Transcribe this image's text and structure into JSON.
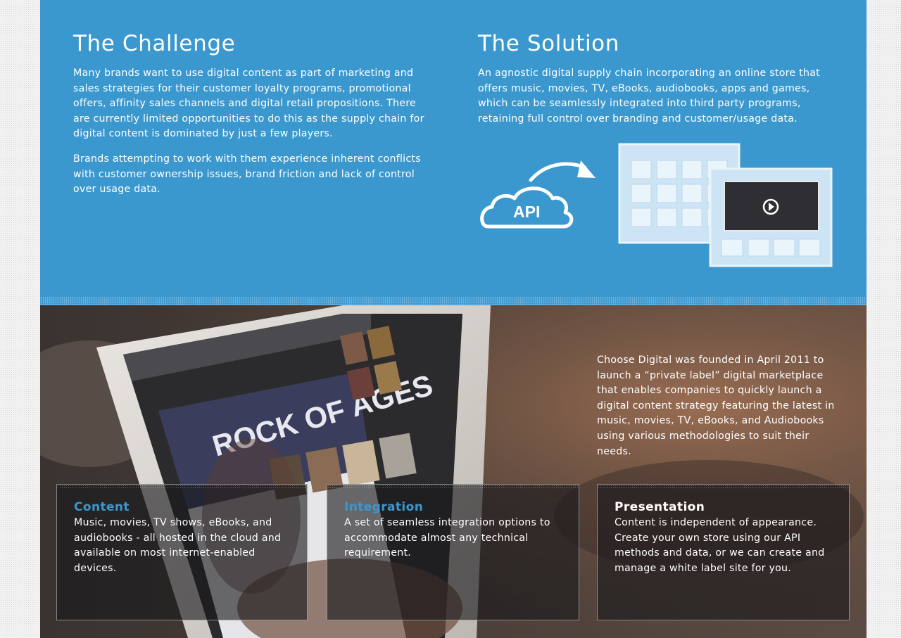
{
  "challenge": {
    "title": "The Challenge",
    "para1": "Many brands want to use digital content as part of marketing and sales strategies for their customer loyalty programs, promotional offers, affinity sales channels and digital retail propositions. There are currently limited opportunities to do this as the supply chain for digital content is dominated by just a few players.",
    "para2": "Brands attempting to work with them experience inherent conflicts with customer ownership issues, brand friction and lack of control over usage data."
  },
  "solution": {
    "title": "The Solution",
    "para1": "An agnostic digital supply chain incorporating an online store that offers music, movies, TV, eBooks, audiobooks, apps and games, which can be seamlessly integrated into third party programs, retaining full control over branding and customer/usage data.",
    "api_label": "API"
  },
  "tablet": {
    "headline": "ROCK OF AGES"
  },
  "intro": {
    "text": "Choose Digital was founded in April 2011 to launch a “private label” digital marketplace that enables companies to quickly launch a digital content strategy featuring the latest in music, movies, TV, eBooks, and Audiobooks using various methodologies to suit their needs."
  },
  "cards": [
    {
      "title": "Content",
      "text": "Music, movies, TV shows, eBooks, and audiobooks - all hosted in the cloud and available on most internet-enabled devices."
    },
    {
      "title": "Integration",
      "text": "A set of seamless integration options to accommodate almost any technical requirement."
    },
    {
      "title": "Presentation",
      "text": "Content is independent of appearance. Create your own store using our API methods and data, or we can create and manage a white label site for you."
    }
  ],
  "colors": {
    "accent_blue": "#3b98cf",
    "white": "#ffffff",
    "card_bg": "#19191c"
  }
}
